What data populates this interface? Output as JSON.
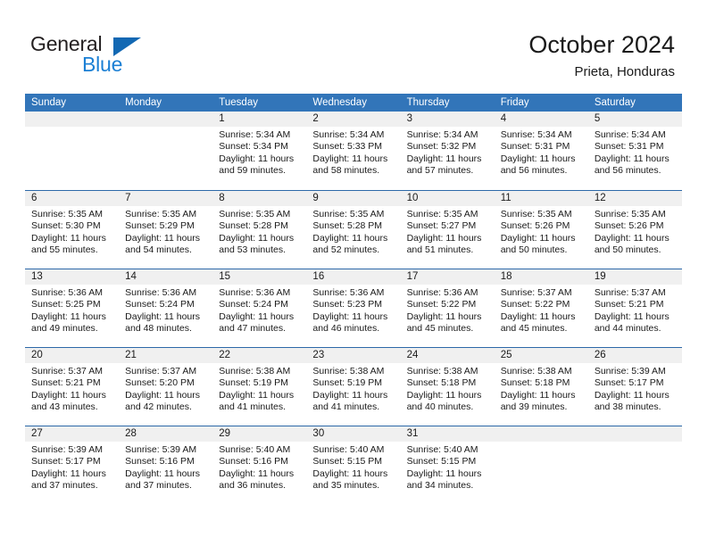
{
  "brand": {
    "name_part1": "General",
    "name_part2": "Blue",
    "triangle_icon": "triangle-icon",
    "accent_color": "#1268b3",
    "blue_text_color": "#1b7fd4"
  },
  "header": {
    "title": "October 2024",
    "subtitle": "Prieta, Honduras"
  },
  "calendar": {
    "header_bg_color": "#3275b9",
    "date_band_color": "#f0f0f0",
    "weekday_headers": [
      "Sunday",
      "Monday",
      "Tuesday",
      "Wednesday",
      "Thursday",
      "Friday",
      "Saturday"
    ],
    "weeks": [
      [
        {
          "date": "",
          "empty": true
        },
        {
          "date": "",
          "empty": true
        },
        {
          "date": "1",
          "sunrise": "Sunrise: 5:34 AM",
          "sunset": "Sunset: 5:34 PM",
          "daylight": "Daylight: 11 hours and 59 minutes."
        },
        {
          "date": "2",
          "sunrise": "Sunrise: 5:34 AM",
          "sunset": "Sunset: 5:33 PM",
          "daylight": "Daylight: 11 hours and 58 minutes."
        },
        {
          "date": "3",
          "sunrise": "Sunrise: 5:34 AM",
          "sunset": "Sunset: 5:32 PM",
          "daylight": "Daylight: 11 hours and 57 minutes."
        },
        {
          "date": "4",
          "sunrise": "Sunrise: 5:34 AM",
          "sunset": "Sunset: 5:31 PM",
          "daylight": "Daylight: 11 hours and 56 minutes."
        },
        {
          "date": "5",
          "sunrise": "Sunrise: 5:34 AM",
          "sunset": "Sunset: 5:31 PM",
          "daylight": "Daylight: 11 hours and 56 minutes."
        }
      ],
      [
        {
          "date": "6",
          "sunrise": "Sunrise: 5:35 AM",
          "sunset": "Sunset: 5:30 PM",
          "daylight": "Daylight: 11 hours and 55 minutes."
        },
        {
          "date": "7",
          "sunrise": "Sunrise: 5:35 AM",
          "sunset": "Sunset: 5:29 PM",
          "daylight": "Daylight: 11 hours and 54 minutes."
        },
        {
          "date": "8",
          "sunrise": "Sunrise: 5:35 AM",
          "sunset": "Sunset: 5:28 PM",
          "daylight": "Daylight: 11 hours and 53 minutes."
        },
        {
          "date": "9",
          "sunrise": "Sunrise: 5:35 AM",
          "sunset": "Sunset: 5:28 PM",
          "daylight": "Daylight: 11 hours and 52 minutes."
        },
        {
          "date": "10",
          "sunrise": "Sunrise: 5:35 AM",
          "sunset": "Sunset: 5:27 PM",
          "daylight": "Daylight: 11 hours and 51 minutes."
        },
        {
          "date": "11",
          "sunrise": "Sunrise: 5:35 AM",
          "sunset": "Sunset: 5:26 PM",
          "daylight": "Daylight: 11 hours and 50 minutes."
        },
        {
          "date": "12",
          "sunrise": "Sunrise: 5:35 AM",
          "sunset": "Sunset: 5:26 PM",
          "daylight": "Daylight: 11 hours and 50 minutes."
        }
      ],
      [
        {
          "date": "13",
          "sunrise": "Sunrise: 5:36 AM",
          "sunset": "Sunset: 5:25 PM",
          "daylight": "Daylight: 11 hours and 49 minutes."
        },
        {
          "date": "14",
          "sunrise": "Sunrise: 5:36 AM",
          "sunset": "Sunset: 5:24 PM",
          "daylight": "Daylight: 11 hours and 48 minutes."
        },
        {
          "date": "15",
          "sunrise": "Sunrise: 5:36 AM",
          "sunset": "Sunset: 5:24 PM",
          "daylight": "Daylight: 11 hours and 47 minutes."
        },
        {
          "date": "16",
          "sunrise": "Sunrise: 5:36 AM",
          "sunset": "Sunset: 5:23 PM",
          "daylight": "Daylight: 11 hours and 46 minutes."
        },
        {
          "date": "17",
          "sunrise": "Sunrise: 5:36 AM",
          "sunset": "Sunset: 5:22 PM",
          "daylight": "Daylight: 11 hours and 45 minutes."
        },
        {
          "date": "18",
          "sunrise": "Sunrise: 5:37 AM",
          "sunset": "Sunset: 5:22 PM",
          "daylight": "Daylight: 11 hours and 45 minutes."
        },
        {
          "date": "19",
          "sunrise": "Sunrise: 5:37 AM",
          "sunset": "Sunset: 5:21 PM",
          "daylight": "Daylight: 11 hours and 44 minutes."
        }
      ],
      [
        {
          "date": "20",
          "sunrise": "Sunrise: 5:37 AM",
          "sunset": "Sunset: 5:21 PM",
          "daylight": "Daylight: 11 hours and 43 minutes."
        },
        {
          "date": "21",
          "sunrise": "Sunrise: 5:37 AM",
          "sunset": "Sunset: 5:20 PM",
          "daylight": "Daylight: 11 hours and 42 minutes."
        },
        {
          "date": "22",
          "sunrise": "Sunrise: 5:38 AM",
          "sunset": "Sunset: 5:19 PM",
          "daylight": "Daylight: 11 hours and 41 minutes."
        },
        {
          "date": "23",
          "sunrise": "Sunrise: 5:38 AM",
          "sunset": "Sunset: 5:19 PM",
          "daylight": "Daylight: 11 hours and 41 minutes."
        },
        {
          "date": "24",
          "sunrise": "Sunrise: 5:38 AM",
          "sunset": "Sunset: 5:18 PM",
          "daylight": "Daylight: 11 hours and 40 minutes."
        },
        {
          "date": "25",
          "sunrise": "Sunrise: 5:38 AM",
          "sunset": "Sunset: 5:18 PM",
          "daylight": "Daylight: 11 hours and 39 minutes."
        },
        {
          "date": "26",
          "sunrise": "Sunrise: 5:39 AM",
          "sunset": "Sunset: 5:17 PM",
          "daylight": "Daylight: 11 hours and 38 minutes."
        }
      ],
      [
        {
          "date": "27",
          "sunrise": "Sunrise: 5:39 AM",
          "sunset": "Sunset: 5:17 PM",
          "daylight": "Daylight: 11 hours and 37 minutes."
        },
        {
          "date": "28",
          "sunrise": "Sunrise: 5:39 AM",
          "sunset": "Sunset: 5:16 PM",
          "daylight": "Daylight: 11 hours and 37 minutes."
        },
        {
          "date": "29",
          "sunrise": "Sunrise: 5:40 AM",
          "sunset": "Sunset: 5:16 PM",
          "daylight": "Daylight: 11 hours and 36 minutes."
        },
        {
          "date": "30",
          "sunrise": "Sunrise: 5:40 AM",
          "sunset": "Sunset: 5:15 PM",
          "daylight": "Daylight: 11 hours and 35 minutes."
        },
        {
          "date": "31",
          "sunrise": "Sunrise: 5:40 AM",
          "sunset": "Sunset: 5:15 PM",
          "daylight": "Daylight: 11 hours and 34 minutes."
        },
        {
          "date": "",
          "empty": true
        },
        {
          "date": "",
          "empty": true
        }
      ]
    ]
  }
}
